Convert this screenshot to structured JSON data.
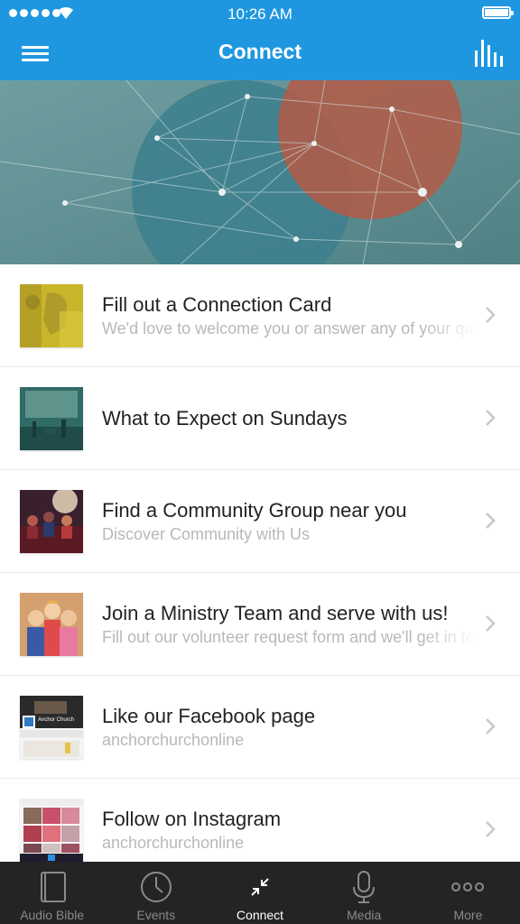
{
  "status_bar": {
    "time": "10:26 AM"
  },
  "header": {
    "title": "Connect"
  },
  "items": [
    {
      "title": "Fill out a Connection Card",
      "subtitle": "We'd love to welcome you or answer any of your questions"
    },
    {
      "title": "What to Expect on Sundays",
      "subtitle": ""
    },
    {
      "title": "Find a Community Group near you",
      "subtitle": "Discover Community with Us"
    },
    {
      "title": "Join a Ministry Team and serve with us!",
      "subtitle": "Fill out our volunteer request form and we'll get in touch"
    },
    {
      "title": "Like our Facebook page",
      "subtitle": "anchorchurchonline"
    },
    {
      "title": "Follow on Instagram",
      "subtitle": "anchorchurchonline"
    }
  ],
  "thumbnails": {
    "facebook_name": "Anchor Church"
  },
  "tabs": [
    {
      "label": "Audio Bible",
      "icon": "book-icon"
    },
    {
      "label": "Events",
      "icon": "clock-icon"
    },
    {
      "label": "Connect",
      "icon": "connect-arrows-icon"
    },
    {
      "label": "Media",
      "icon": "microphone-icon"
    },
    {
      "label": "More",
      "icon": "more-dots-icon"
    }
  ],
  "colors": {
    "accent": "#1f97e0",
    "tabbar": "#242424",
    "hero_teal": "#5f9295",
    "hero_circle_red": "#b05a45"
  }
}
